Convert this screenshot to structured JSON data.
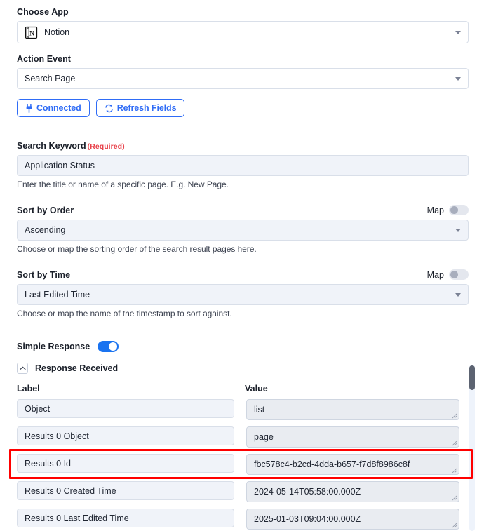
{
  "app_field": {
    "label": "Choose App",
    "value": "Notion",
    "icon": "notion-logo-icon",
    "caret": "chevron-down-icon"
  },
  "action_field": {
    "label": "Action Event",
    "value": "Search Page",
    "caret": "chevron-down-icon"
  },
  "buttons": {
    "connected": {
      "label": "Connected",
      "icon": "plug-icon"
    },
    "refresh": {
      "label": "Refresh Fields",
      "icon": "refresh-icon"
    }
  },
  "search_keyword": {
    "label": "Search Keyword",
    "required_text": "(Required)",
    "value": "Application Status",
    "help": "Enter the title or name of a specific page. E.g. New Page."
  },
  "sort_by_order": {
    "label": "Sort by Order",
    "map_label": "Map",
    "map_on": false,
    "value": "Ascending",
    "help": "Choose or map the sorting order of the search result pages here."
  },
  "sort_by_time": {
    "label": "Sort by Time",
    "map_label": "Map",
    "map_on": false,
    "value": "Last Edited Time",
    "help": "Choose or map the name of the timestamp to sort against."
  },
  "simple_response": {
    "label": "Simple Response",
    "on": true
  },
  "response_received": {
    "label": "Response Received",
    "expander_icon": "chevron-up-icon",
    "columns": {
      "label": "Label",
      "value": "Value"
    },
    "rows": [
      {
        "label": "Object",
        "value": "list",
        "highlighted": false
      },
      {
        "label": "Results 0 Object",
        "value": "page",
        "highlighted": false
      },
      {
        "label": "Results 0 Id",
        "value": "fbc578c4-b2cd-4dda-b657-f7d8f8986c8f",
        "highlighted": true
      },
      {
        "label": "Results 0 Created Time",
        "value": "2024-05-14T05:58:00.000Z",
        "highlighted": false
      },
      {
        "label": "Results 0 Last Edited Time",
        "value": "2025-01-03T09:04:00.000Z",
        "highlighted": false
      }
    ]
  },
  "colors": {
    "accent": "#2f6cf6",
    "toggle_on": "#1a73f0",
    "required": "#e8414a",
    "highlight": "#ff0000",
    "input_bg": "#f0f3f9",
    "value_bg": "#e9ecf1"
  }
}
